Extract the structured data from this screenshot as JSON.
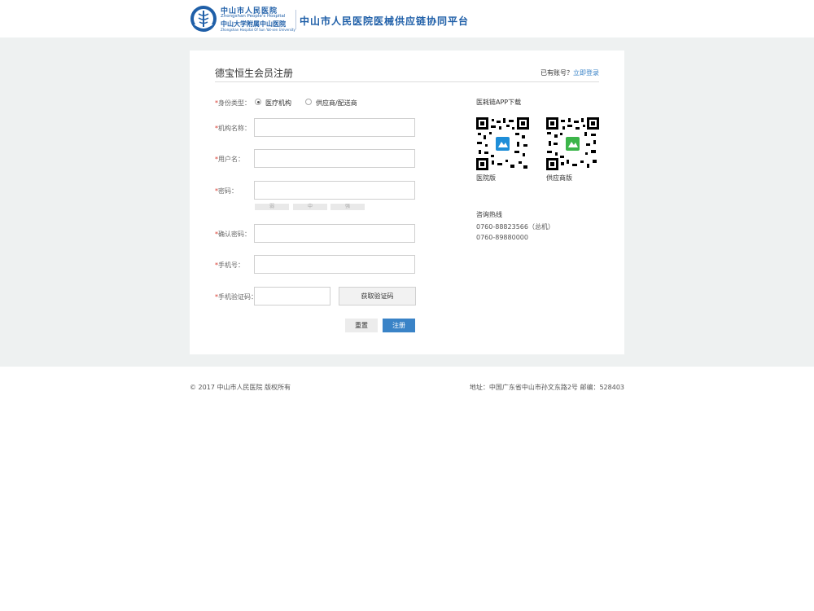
{
  "header": {
    "logo_cn_line1": "中山市人民医院",
    "logo_en_line1": "Zhongshan People's Hospital",
    "logo_cn_line2": "中山大学附属中山医院",
    "logo_en_line2": "Zhongshan Hospital Of Sun Yat-sen University",
    "platform_title": "中山市人民医院医械供应链协同平台"
  },
  "card": {
    "title": "德宝恒生会员注册",
    "login_hint": "已有账号？",
    "login_link": "立即登录"
  },
  "form": {
    "required_mark": "*",
    "identity_label": "身份类型：",
    "identity_options": [
      "医疗机构",
      "供应商/配送商"
    ],
    "identity_selected": "医疗机构",
    "org_label": "机构名称：",
    "username_label": "用户名：",
    "password_label": "密码：",
    "password_strength": [
      "弱",
      "中",
      "强"
    ],
    "confirm_label": "确认密码：",
    "phone_label": "手机号：",
    "sms_label": "手机验证码：",
    "sms_button": "获取验证码",
    "reset_button": "重置",
    "submit_button": "注册"
  },
  "sidebar": {
    "app_heading": "医耗链APP下载",
    "qr_captions": [
      "医院版",
      "供应商版"
    ],
    "hotline_heading": "咨询热线",
    "phones": [
      "0760-88823566（总机）",
      "0760-89880000"
    ]
  },
  "footer": {
    "copyright": "© 2017 中山市人民医院 版权所有",
    "address": "地址：中国广东省中山市孙文东路2号 邮编：528403"
  },
  "colors": {
    "brand": "#1f5fa8",
    "accent": "#3a83c7",
    "required": "#d83a2f",
    "band": "#eef1f1"
  }
}
